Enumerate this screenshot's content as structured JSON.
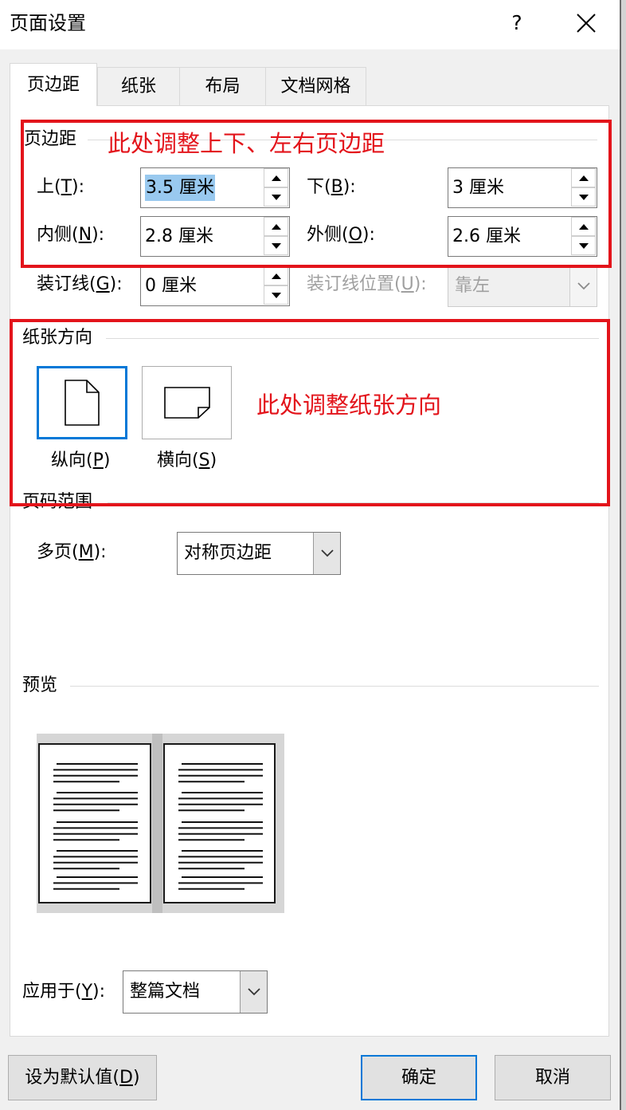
{
  "window": {
    "title": "页面设置",
    "help_label": "?"
  },
  "tabs": [
    {
      "label": "页边距",
      "selected": true
    },
    {
      "label": "纸张",
      "selected": false
    },
    {
      "label": "布局",
      "selected": false
    },
    {
      "label": "文档网格",
      "selected": false
    }
  ],
  "margins": {
    "heading": "页边距",
    "annotation": "此处调整上下、左右页边距",
    "top": {
      "label": "上(T):",
      "key": "T",
      "value": "3.5 厘米",
      "text_selected": true
    },
    "bottom": {
      "label": "下(B):",
      "key": "B",
      "value": "3 厘米"
    },
    "inside": {
      "label": "内侧(N):",
      "key": "N",
      "value": "2.8 厘米"
    },
    "outside": {
      "label": "外侧(O):",
      "key": "O",
      "value": "2.6 厘米"
    },
    "gutter": {
      "label": "装订线(G):",
      "key": "G",
      "value": "0 厘米"
    },
    "gutter_position": {
      "label": "装订线位置(U):",
      "key": "U",
      "value": "靠左",
      "disabled": true
    }
  },
  "orientation": {
    "heading": "纸张方向",
    "annotation": "此处调整纸张方向",
    "portrait": {
      "label": "纵向(P)",
      "key": "P",
      "selected": true,
      "icon": "portrait-page-icon"
    },
    "landscape": {
      "label": "横向(S)",
      "key": "S",
      "selected": false,
      "icon": "landscape-page-icon"
    }
  },
  "pages": {
    "heading": "页码范围",
    "multiple_pages": {
      "label": "多页(M):",
      "key": "M",
      "value": "对称页边距"
    }
  },
  "preview": {
    "heading": "预览"
  },
  "apply_to": {
    "label": "应用于(Y):",
    "key": "Y",
    "value": "整篇文档"
  },
  "buttons": {
    "set_default": {
      "label": "设为默认值(D)",
      "key": "D"
    },
    "ok": {
      "label": "确定",
      "focused": true
    },
    "cancel": {
      "label": "取消"
    }
  },
  "colors": {
    "annotation_red": "#e3141b",
    "focus_blue": "#0078d7",
    "selection_blue": "#99c9ef",
    "disabled_text": "#a0a0a0"
  }
}
